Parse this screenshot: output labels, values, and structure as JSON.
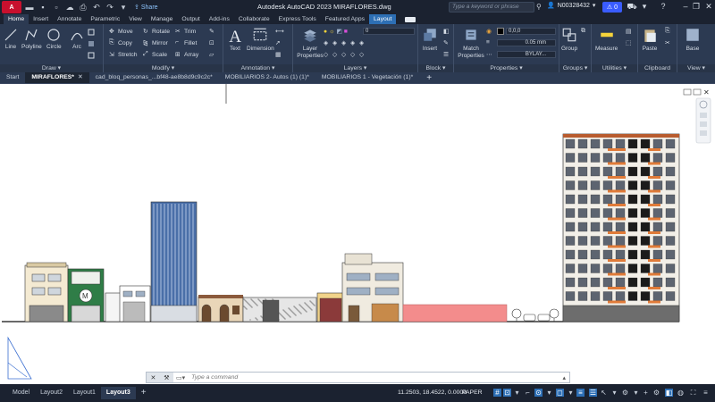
{
  "titlebar": {
    "logo_text": "A",
    "logo_sub": "CAD",
    "share_label": "Share",
    "window_title": "Autodesk AutoCAD 2023   MIRAFLORES.dwg",
    "search_placeholder": "Type a keyword or phrase",
    "username": "N00328432",
    "notification_count": "0"
  },
  "ribbon_tabs": [
    "Home",
    "Insert",
    "Annotate",
    "Parametric",
    "View",
    "Manage",
    "Output",
    "Add-ins",
    "Collaborate",
    "Express Tools",
    "Featured Apps",
    "Layout"
  ],
  "ribbon": {
    "draw": {
      "title": "Draw",
      "line": "Line",
      "polyline": "Polyline",
      "circle": "Circle",
      "arc": "Arc"
    },
    "modify": {
      "title": "Modify",
      "move": "Move",
      "copy": "Copy",
      "stretch": "Stretch",
      "rotate": "Rotate",
      "mirror": "Mirror",
      "scale": "Scale",
      "trim": "Trim",
      "fillet": "Fillet",
      "array": "Array"
    },
    "annotation": {
      "title": "Annotation",
      "text": "Text",
      "dimension": "Dimension"
    },
    "layers": {
      "title": "Layers",
      "layer_properties": "Layer Properties",
      "current_layer": "0"
    },
    "block": {
      "title": "Block",
      "insert": "Insert"
    },
    "properties": {
      "title": "Properties",
      "match": "Match Properties",
      "color": "0,0,0",
      "lineweight": "0.05 mm",
      "linetype": "BYLAY..."
    },
    "groups": {
      "title": "Groups",
      "group": "Group"
    },
    "utilities": {
      "title": "Utilities",
      "measure": "Measure"
    },
    "clipboard": {
      "title": "Clipboard",
      "paste": "Paste"
    },
    "view": {
      "title": "View",
      "base": "Base"
    }
  },
  "file_tabs": [
    {
      "label": "Start",
      "active": false
    },
    {
      "label": "MIRAFLORES*",
      "active": true
    },
    {
      "label": "cad_bloq_personas_...bf48-ae8b8d9c9c2c*",
      "active": false
    },
    {
      "label": "MOBILIARIOS 2- Autos (1) (1)*",
      "active": false
    },
    {
      "label": "MOBILIARIOS 1 - Vegetación (1)*",
      "active": false
    }
  ],
  "command": {
    "placeholder": "Type a command"
  },
  "layout_tabs": [
    "Model",
    "Layout2",
    "Layout1",
    "Layout3"
  ],
  "active_layout": "Layout3",
  "status": {
    "coords": "11.2503, 18.4522, 0.0000",
    "space": "PAPER"
  },
  "colors": {
    "accent": "#2d6fb5",
    "ribbon_bg": "#2c3a52",
    "titlebar_bg": "#1b2230",
    "logo_red": "#c8102e",
    "balcony_orange": "#e07b39",
    "wall_pink": "#f38c8c"
  }
}
